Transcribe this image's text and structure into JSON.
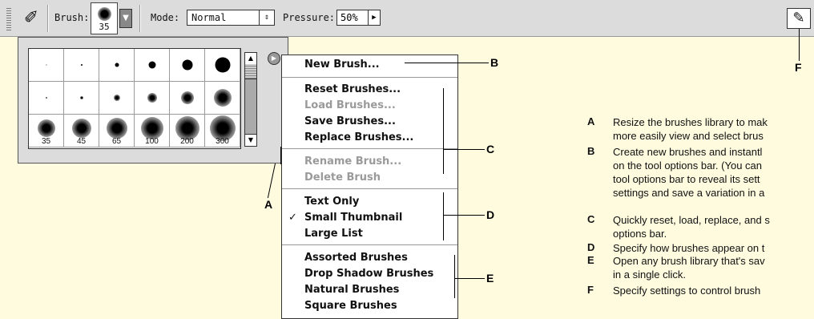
{
  "toolbar": {
    "brush_label": "Brush:",
    "brush_size": "35",
    "mode_label": "Mode:",
    "mode_value": "Normal",
    "pressure_label": "Pressure:",
    "pressure_value": "50%",
    "tool_icon": "brush-tool-icon",
    "palette_icon": "brush-palette-icon"
  },
  "brush_library": {
    "rows": [
      {
        "labels": [
          "",
          "",
          "",
          "",
          "",
          ""
        ],
        "type": "hard",
        "sizes": [
          1,
          2,
          5,
          9,
          13,
          19
        ]
      },
      {
        "labels": [
          "",
          "",
          "",
          "",
          "",
          ""
        ],
        "type": "soft",
        "sizes": [
          2,
          4,
          8,
          12,
          16,
          22
        ]
      },
      {
        "labels": [
          "35",
          "45",
          "65",
          "100",
          "200",
          "300"
        ],
        "type": "soft-big",
        "sizes": [
          22,
          24,
          26,
          28,
          30,
          32
        ]
      }
    ]
  },
  "menu": {
    "items": [
      {
        "label": "New Brush...",
        "disabled": false,
        "checked": false
      },
      {
        "label": "Reset Brushes...",
        "disabled": false,
        "checked": false
      },
      {
        "label": "Load Brushes...",
        "disabled": true,
        "checked": false
      },
      {
        "label": "Save Brushes...",
        "disabled": false,
        "checked": false
      },
      {
        "label": "Replace Brushes...",
        "disabled": false,
        "checked": false
      },
      {
        "label": "Rename Brush...",
        "disabled": true,
        "checked": false
      },
      {
        "label": "Delete Brush",
        "disabled": true,
        "checked": false
      },
      {
        "label": "Text Only",
        "disabled": false,
        "checked": false
      },
      {
        "label": "Small Thumbnail",
        "disabled": false,
        "checked": true
      },
      {
        "label": "Large List",
        "disabled": false,
        "checked": false
      },
      {
        "label": "Assorted Brushes",
        "disabled": false,
        "checked": false
      },
      {
        "label": "Drop Shadow Brushes",
        "disabled": false,
        "checked": false
      },
      {
        "label": "Natural Brushes",
        "disabled": false,
        "checked": false
      },
      {
        "label": "Square Brushes",
        "disabled": false,
        "checked": false
      }
    ]
  },
  "callouts": {
    "a": "A",
    "b": "B",
    "c": "C",
    "d": "D",
    "e": "E",
    "f": "F"
  },
  "legend": [
    {
      "key": "A",
      "lines": [
        "Resize the brushes library to mak",
        "more easily view and select brus"
      ]
    },
    {
      "key": "B",
      "lines": [
        "Create new brushes and instantl",
        "on the tool options bar. (You can",
        "tool options bar to reveal its sett",
        "settings and save a variation in a"
      ]
    },
    {
      "key": "C",
      "lines": [
        "Quickly reset, load, replace, and s",
        "options bar."
      ]
    },
    {
      "key": "D",
      "lines": [
        "Specify how brushes appear on t"
      ]
    },
    {
      "key": "E",
      "lines": [
        "Open any brush library that's sav",
        "in a single click."
      ]
    },
    {
      "key": "F",
      "lines": [
        "Specify settings to control brush"
      ]
    }
  ]
}
